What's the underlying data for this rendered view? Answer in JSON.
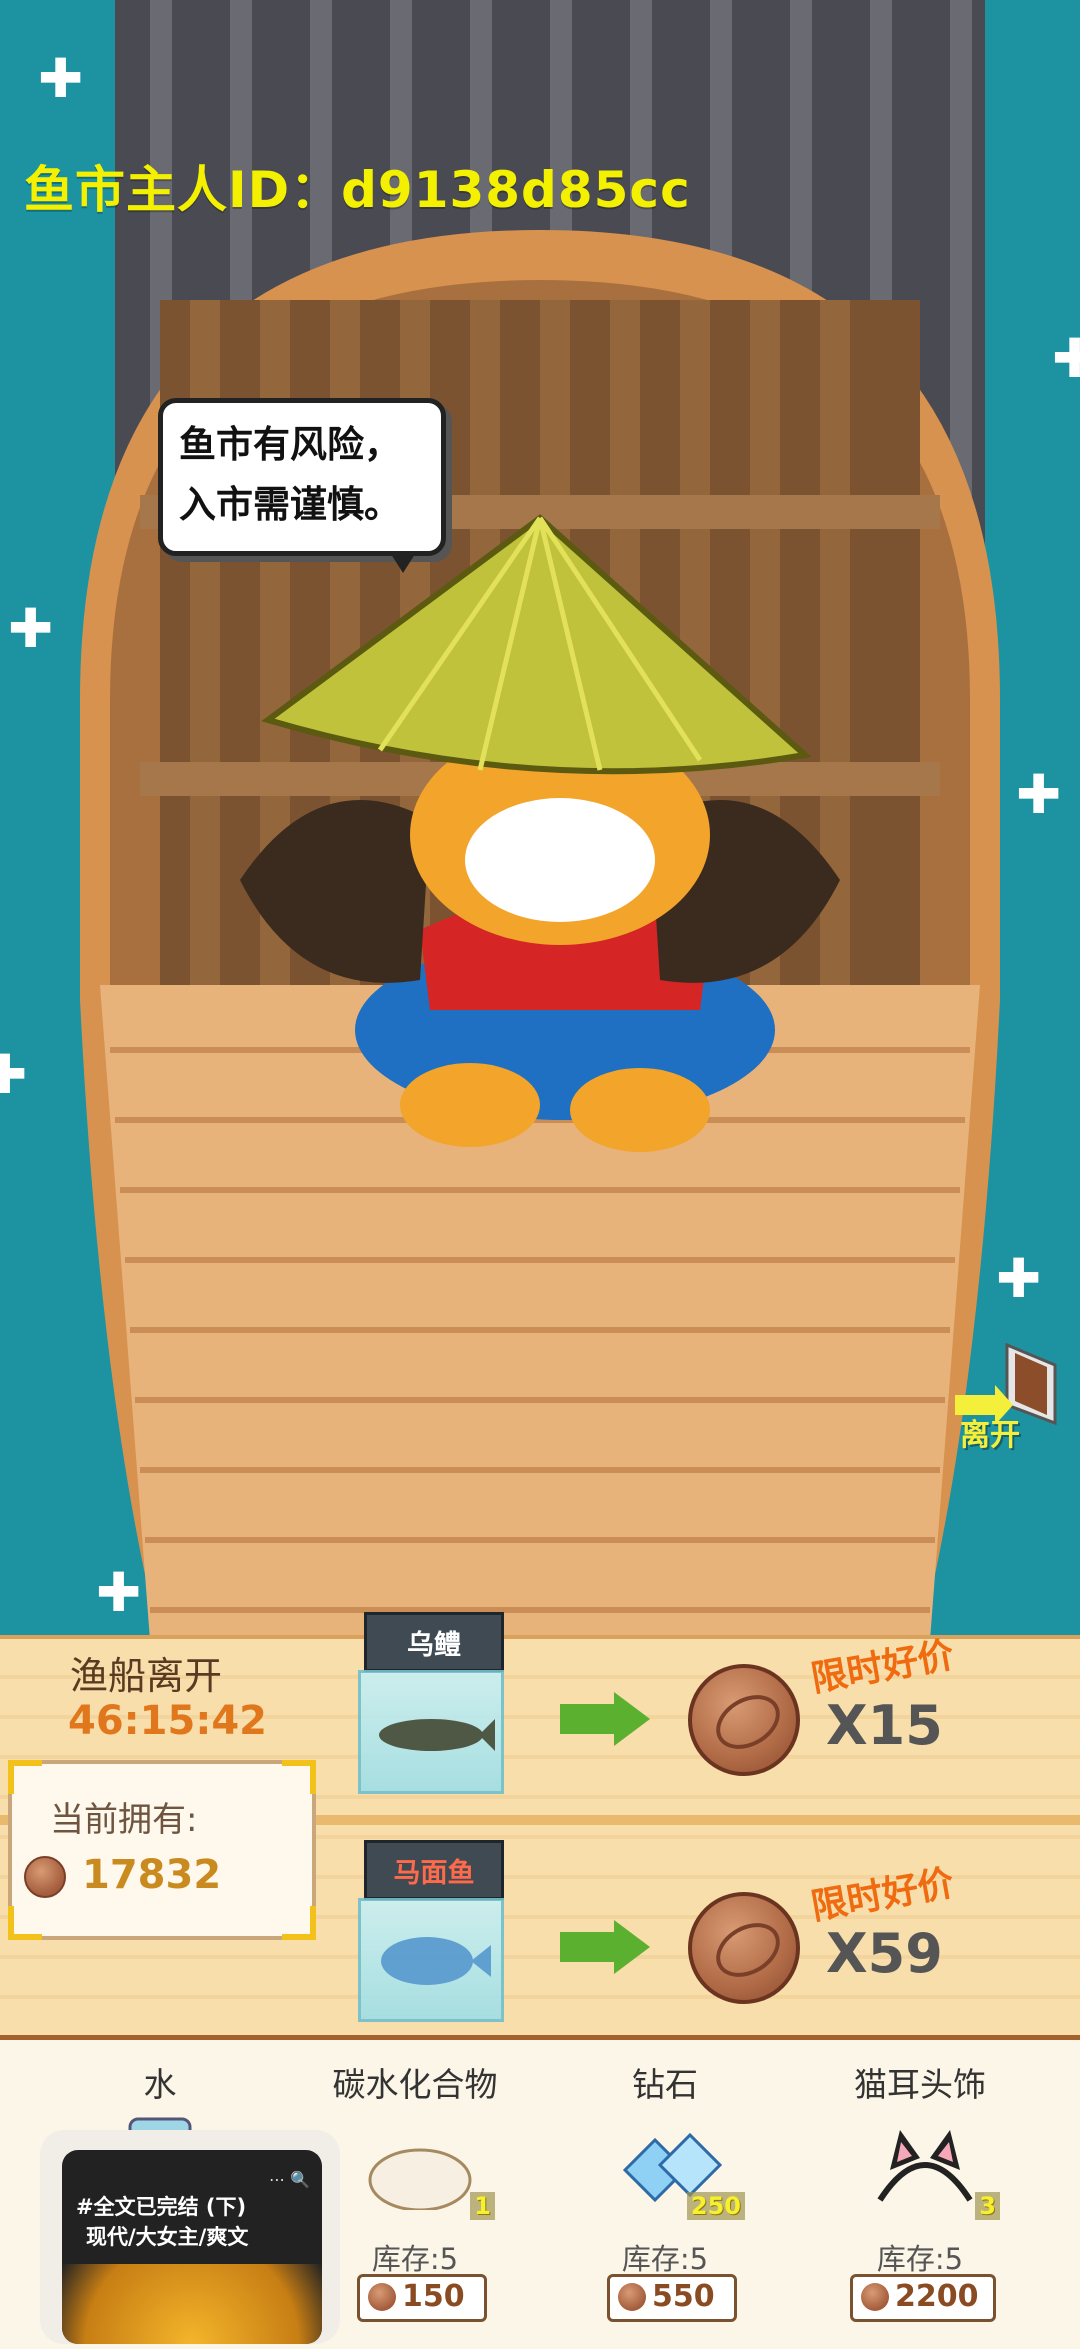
{
  "header": {
    "owner_id": "鱼市主人ID：d9138d85cc"
  },
  "speech_bubble": {
    "text": "鱼市有风险，\n入市需谨慎。"
  },
  "leave_button": {
    "label": "离开"
  },
  "boat_status": {
    "label": "渔船离开",
    "timer": "46:15:42"
  },
  "currency": {
    "label": "当前拥有:",
    "value": "17832"
  },
  "trades": [
    {
      "fish": "乌鳢",
      "promo": "限时好价",
      "quantity": "X15"
    },
    {
      "fish": "马面鱼",
      "promo": "限时好价",
      "quantity": "X59"
    }
  ],
  "shop": [
    {
      "name": "水",
      "count": "",
      "stock": "",
      "price": ""
    },
    {
      "name": "碳水化合物",
      "count": "1",
      "stock": "库存:5",
      "price": "150"
    },
    {
      "name": "钻石",
      "count": "250",
      "stock": "库存:5",
      "price": "550"
    },
    {
      "name": "猫耳头饰",
      "count": "3",
      "stock": "库存:5",
      "price": "2200"
    }
  ],
  "overlay": {
    "text_line1": "#全文已完结 (下)",
    "text_line2": "现代/大女主/爽文",
    "icons": "⋯ 🔍"
  }
}
